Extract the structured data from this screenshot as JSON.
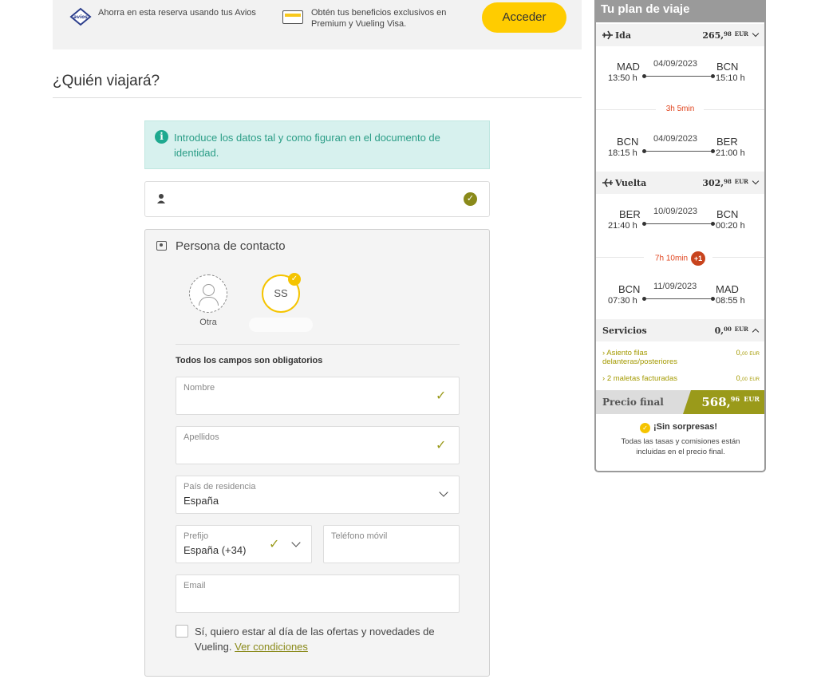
{
  "banner": {
    "avios_logo": "avios",
    "avios_text": "Ahorra en esta reserva usando tus Avios",
    "premium_text": "Obtén tus beneficios exclusivos en Premium y Vueling Visa.",
    "login_button": "Acceder"
  },
  "section_title": "¿Quién viajará?",
  "info_box": {
    "icon": "info-icon",
    "text": "Introduce los datos tal y como figuran en el documento de identidad."
  },
  "contact": {
    "title": "Persona de contacto",
    "avatar_other_label": "Otra",
    "avatar_selected_initials": "SS",
    "required_note": "Todos los campos son obligatorios",
    "fields": {
      "first_name": {
        "label": "Nombre",
        "value": ""
      },
      "last_name": {
        "label": "Apellidos",
        "value": ""
      },
      "country": {
        "label": "País de residencia",
        "value": "España"
      },
      "prefix": {
        "label": "Prefijo",
        "value": "España (+34)"
      },
      "phone": {
        "label": "Teléfono móvil",
        "value": ""
      },
      "email": {
        "label": "Email",
        "value": ""
      }
    },
    "optin_text": "Sí, quiero estar al día de las ofertas y novedades de Vueling.",
    "optin_link": "Ver condiciones"
  },
  "plan": {
    "title": "Tu plan de viaje",
    "outbound": {
      "label": "Ida",
      "price_int": "265,",
      "price_dec": "98",
      "currency": "EUR",
      "segments": [
        {
          "from": "MAD",
          "from_time": "13:50 h",
          "date": "04/09/2023",
          "to": "BCN",
          "to_time": "15:10 h"
        },
        {
          "from": "BCN",
          "from_time": "18:15 h",
          "date": "04/09/2023",
          "to": "BER",
          "to_time": "21:00 h"
        }
      ],
      "layover": "3h  5min"
    },
    "return": {
      "label": "Vuelta",
      "price_int": "302,",
      "price_dec": "98",
      "currency": "EUR",
      "segments": [
        {
          "from": "BER",
          "from_time": "21:40 h",
          "date": "10/09/2023",
          "to": "BCN",
          "to_time": "00:20 h"
        },
        {
          "from": "BCN",
          "from_time": "07:30 h",
          "date": "11/09/2023",
          "to": "MAD",
          "to_time": "08:55 h"
        }
      ],
      "layover": "7h  10min",
      "day_change": "+1"
    },
    "services": {
      "label": "Servicios",
      "price_int": "0,",
      "price_dec": "00",
      "currency": "EUR",
      "items": [
        {
          "name": "Asiento filas delanteras/posteriores",
          "price_int": "0,",
          "price_dec": "00",
          "currency": "EUR"
        },
        {
          "name": "2 maletas facturadas",
          "price_int": "0,",
          "price_dec": "00",
          "currency": "EUR"
        }
      ]
    },
    "final": {
      "label": "Precio final",
      "price_int": "568,",
      "price_dec": "96",
      "currency": "EUR"
    },
    "no_surprises_title": "¡Sin sorpresas!",
    "no_surprises_text": "Todas las tasas y comisiones están incluidas en el precio final."
  },
  "colors": {
    "brand_yellow": "#ffcc00",
    "olive": "#9a9a1a",
    "info_teal": "#1ea98f",
    "layover_red": "#e0451f"
  }
}
